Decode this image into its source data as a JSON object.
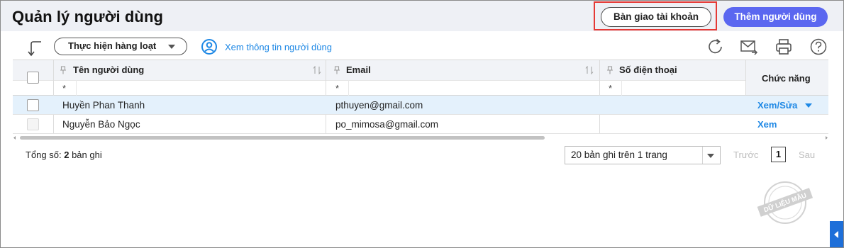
{
  "header": {
    "title": "Quản lý người dùng",
    "transfer_button": "Bàn giao tài khoản",
    "add_button": "Thêm người dùng"
  },
  "toolbar": {
    "bulk_action": "Thực hiện hàng loạt",
    "view_info": "Xem thông tin người dùng",
    "icons": [
      "collapse-arrow-icon",
      "user-circle-icon",
      "refresh-icon",
      "email-send-icon",
      "print-icon",
      "help-icon"
    ]
  },
  "table": {
    "columns": [
      {
        "label": "Tên người dùng",
        "filter": "*"
      },
      {
        "label": "Email",
        "filter": "*"
      },
      {
        "label": "Số điện thoại",
        "filter": "*"
      },
      {
        "label": "Chức năng"
      }
    ],
    "rows": [
      {
        "name": "Huyền Phan Thanh",
        "email": "pthuyen@gmail.com",
        "phone": "",
        "action": "Xem/Sửa",
        "selected_row": true
      },
      {
        "name": "Nguyễn Bảo Ngọc",
        "email": "po_mimosa@gmail.com",
        "phone": "",
        "action": "Xem",
        "selected_row": false
      }
    ]
  },
  "footer": {
    "total_label": "Tổng số:",
    "total_value": "2",
    "total_unit": "bản ghi",
    "page_size": "20 bản ghi trên 1 trang",
    "prev": "Trước",
    "page": "1",
    "next": "Sau"
  },
  "watermark": "DỮ LIỆU MẪU",
  "colors": {
    "accent": "#5b67f0",
    "link": "#1e88e5",
    "highlight": "#e53935",
    "selected_row": "#e4f1fc"
  }
}
